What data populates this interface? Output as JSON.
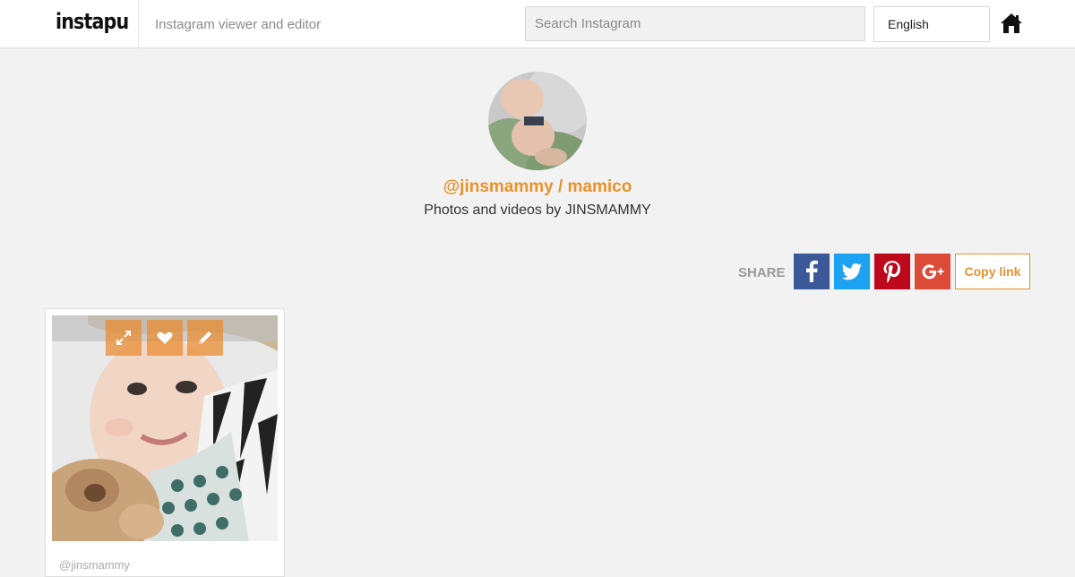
{
  "header": {
    "logo": "instapu",
    "tagline": "Instagram viewer and editor",
    "search_placeholder": "Search Instagram",
    "language": "English",
    "home_icon": "home-icon"
  },
  "profile": {
    "username": "@jinsmammy / mamico",
    "subtitle": "Photos and videos by JINSMAMMY"
  },
  "share": {
    "label": "SHARE",
    "buttons": [
      {
        "name": "facebook",
        "icon": "facebook-icon",
        "color": "#3b5998"
      },
      {
        "name": "twitter",
        "icon": "twitter-icon",
        "color": "#1da1f2"
      },
      {
        "name": "pinterest",
        "icon": "pinterest-icon",
        "color": "#bd081c"
      },
      {
        "name": "google-plus",
        "icon": "google-plus-icon",
        "color": "#dc4a38"
      }
    ],
    "copy_label": "Copy link"
  },
  "posts": [
    {
      "user": "@jinsmammy",
      "actions": [
        "expand-icon",
        "heart-icon",
        "pencil-icon"
      ]
    }
  ],
  "colors": {
    "accent": "#e8922b",
    "background": "#f2f2f2"
  }
}
